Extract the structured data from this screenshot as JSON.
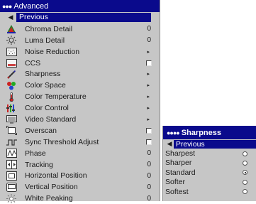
{
  "menu": {
    "title": "Advanced",
    "header_dots": "●●●",
    "previous": "Previous",
    "items": [
      {
        "label": "Chroma Detail",
        "value": "0",
        "icon": "chroma-icon"
      },
      {
        "label": "Luma Detail",
        "value": "0",
        "icon": "luma-icon"
      },
      {
        "label": "Noise Reduction",
        "value": "▸",
        "icon": "noise-icon"
      },
      {
        "label": "CCS",
        "value": "",
        "icon": "ccs-icon"
      },
      {
        "label": "Sharpness",
        "value": "▸",
        "icon": "sharpness-icon"
      },
      {
        "label": "Color Space",
        "value": "▸",
        "icon": "color-space-icon"
      },
      {
        "label": "Color Temperature",
        "value": "▸",
        "icon": "thermometer-icon"
      },
      {
        "label": "Color Control",
        "value": "▸",
        "icon": "color-control-icon"
      },
      {
        "label": "Video Standard",
        "value": "▸",
        "icon": "video-standard-icon"
      },
      {
        "label": "Overscan",
        "value": "",
        "icon": "overscan-icon"
      },
      {
        "label": "Sync Threshold Adjust",
        "value": "",
        "icon": "sync-icon"
      },
      {
        "label": "Phase",
        "value": "0",
        "icon": "phase-icon"
      },
      {
        "label": "Tracking",
        "value": "0",
        "icon": "tracking-icon"
      },
      {
        "label": "Horizontal Position",
        "value": "0",
        "icon": "horizontal-position-icon"
      },
      {
        "label": "Vertical Position",
        "value": "0",
        "icon": "vertical-position-icon"
      },
      {
        "label": "White Peaking",
        "value": "0",
        "icon": "white-peaking-icon"
      }
    ]
  },
  "submenu": {
    "title": "Sharpness",
    "header_dots": "●●●●",
    "previous": "Previous",
    "options": [
      "Sharpest",
      "Sharper",
      "Standard",
      "Softer",
      "Softest"
    ],
    "selected": "Standard"
  },
  "colors": {
    "header_bg": "#0a0a8c",
    "menu_bg": "#c6c6c6"
  }
}
